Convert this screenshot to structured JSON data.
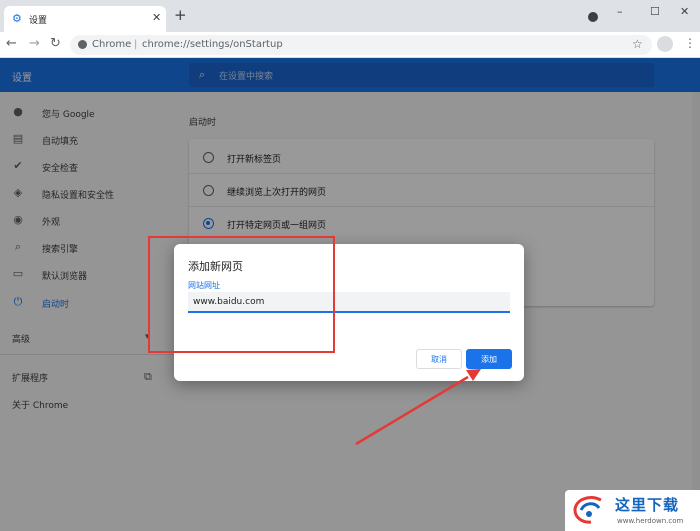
{
  "browser": {
    "tab_title": "设置",
    "omnibox_site": "Chrome",
    "omnibox_separator": "|",
    "omnibox_url": "chrome://settings/onStartup"
  },
  "settings": {
    "header_title": "设置",
    "search_placeholder": "在设置中搜索",
    "sidebar": [
      {
        "label": "您与 Google",
        "icon": "person-icon"
      },
      {
        "label": "自动填充",
        "icon": "clipboard-icon"
      },
      {
        "label": "安全检查",
        "icon": "shield-check-icon"
      },
      {
        "label": "隐私设置和安全性",
        "icon": "shield-icon"
      },
      {
        "label": "外观",
        "icon": "palette-icon"
      },
      {
        "label": "搜索引擎",
        "icon": "search-icon"
      },
      {
        "label": "默认浏览器",
        "icon": "browser-icon"
      },
      {
        "label": "启动时",
        "icon": "power-icon",
        "active": true
      }
    ],
    "advanced_label": "高级",
    "extensions_label": "扩展程序",
    "about_label": "关于 Chrome",
    "section_title": "启动时",
    "startup_options": [
      {
        "label": "打开新标签页",
        "checked": false
      },
      {
        "label": "继续浏览上次打开的网页",
        "checked": false
      },
      {
        "label": "打开特定网页或一组网页",
        "checked": true
      }
    ]
  },
  "dialog": {
    "title": "添加新网页",
    "field_label": "网站网址",
    "input_value": "www.baidu.com",
    "cancel_label": "取消",
    "add_label": "添加"
  },
  "watermark": {
    "title": "这里下载",
    "url": "www.herdown.com"
  },
  "colors": {
    "accent": "#1a73e8",
    "annotation": "#e53935"
  }
}
